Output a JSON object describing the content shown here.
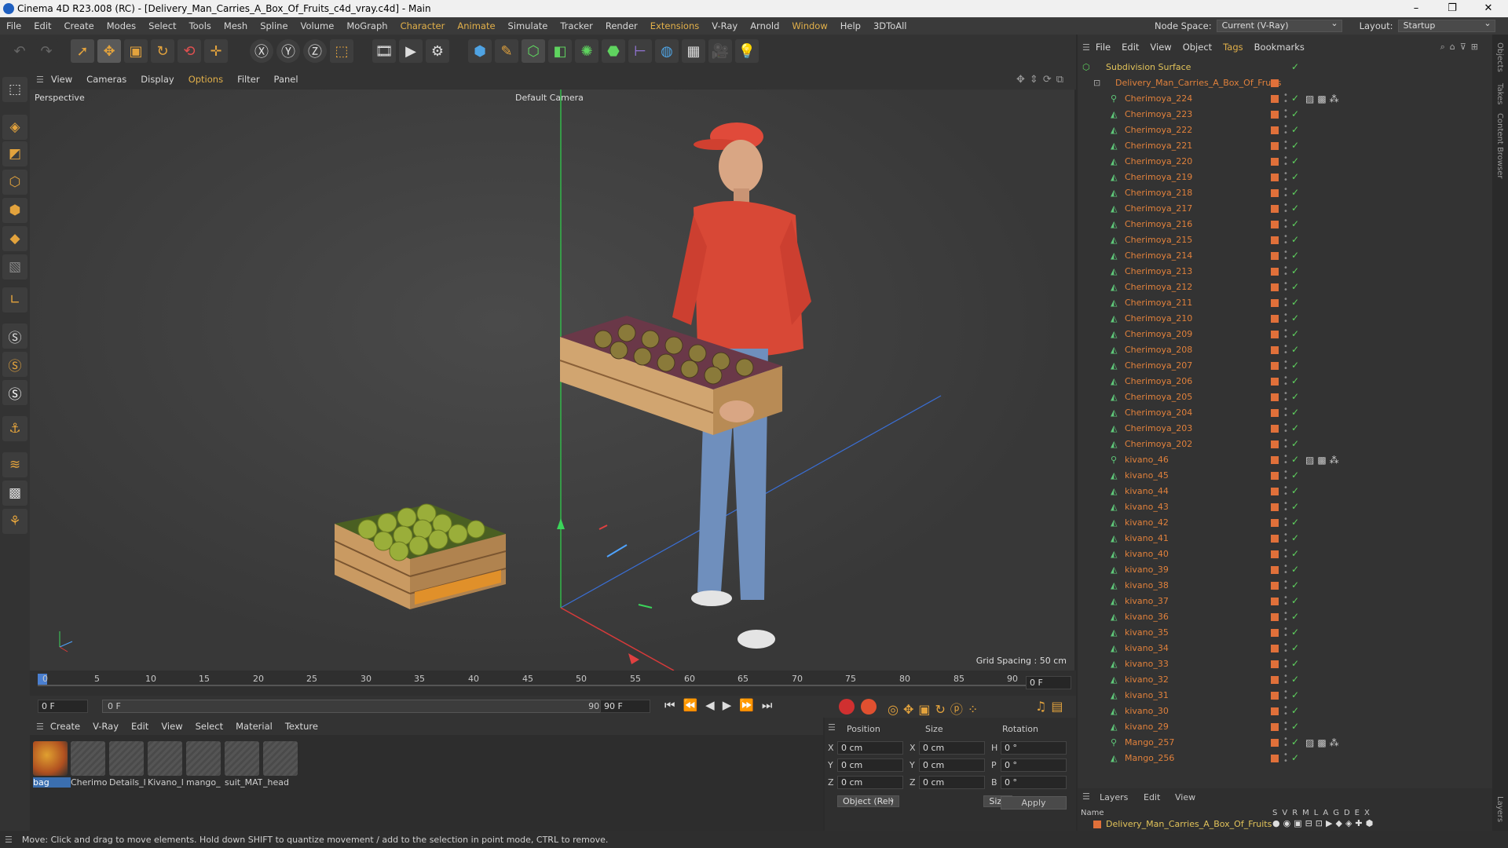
{
  "window": {
    "title": "Cinema 4D R23.008 (RC) - [Delivery_Man_Carries_A_Box_Of_Fruits_c4d_vray.c4d] - Main"
  },
  "menubar": {
    "items": [
      "File",
      "Edit",
      "Create",
      "Modes",
      "Select",
      "Tools",
      "Mesh",
      "Spline",
      "Volume",
      "MoGraph",
      "Character",
      "Animate",
      "Simulate",
      "Tracker",
      "Render",
      "Extensions",
      "V-Ray",
      "Arnold",
      "Window",
      "Help",
      "3DToAll"
    ],
    "node_space_label": "Node Space:",
    "node_space_value": "Current (V-Ray)",
    "layout_label": "Layout:",
    "layout_value": "Startup"
  },
  "viewport": {
    "menu": [
      "View",
      "Cameras",
      "Display",
      "Options",
      "Filter",
      "Panel"
    ],
    "name": "Perspective",
    "camera": "Default Camera",
    "grid_spacing": "Grid Spacing : 50 cm"
  },
  "timeline": {
    "ticks": [
      "0",
      "5",
      "10",
      "15",
      "20",
      "25",
      "30",
      "35",
      "40",
      "45",
      "50",
      "55",
      "60",
      "65",
      "70",
      "75",
      "80",
      "85",
      "90"
    ],
    "current_frame": "0 F",
    "start_field": "0 F",
    "range_start": "0 F",
    "range_end": "90 F",
    "end_field": "90 F",
    "right_field": "0 F"
  },
  "material_manager": {
    "menu": [
      "Create",
      "V-Ray",
      "Edit",
      "View",
      "Select",
      "Material",
      "Texture"
    ],
    "materials": [
      "bag",
      "Cherimo",
      "Details_l",
      "Kivano_l",
      "mango_",
      "suit_MAT",
      "_head"
    ]
  },
  "coordinates": {
    "headers": [
      "Position",
      "Size",
      "Rotation"
    ],
    "pos": {
      "x": "0 cm",
      "y": "0 cm",
      "z": "0 cm"
    },
    "size": {
      "x": "0 cm",
      "y": "0 cm",
      "z": "0 cm"
    },
    "rot": {
      "h": "0 °",
      "p": "0 °",
      "b": "0 °"
    },
    "axis_labels": {
      "x": "X",
      "y": "Y",
      "z": "Z",
      "h": "H",
      "p": "P",
      "b": "B"
    },
    "mode_dropdown": "Object (Rel)",
    "size_dropdown": "Size",
    "apply": "Apply"
  },
  "object_manager": {
    "menu": [
      "File",
      "Edit",
      "View",
      "Object",
      "Tags",
      "Bookmarks"
    ],
    "root": "Subdivision Surface",
    "group": "Delivery_Man_Carries_A_Box_Of_Fruits",
    "objects": [
      "Cherimoya_224",
      "Cherimoya_223",
      "Cherimoya_222",
      "Cherimoya_221",
      "Cherimoya_220",
      "Cherimoya_219",
      "Cherimoya_218",
      "Cherimoya_217",
      "Cherimoya_216",
      "Cherimoya_215",
      "Cherimoya_214",
      "Cherimoya_213",
      "Cherimoya_212",
      "Cherimoya_211",
      "Cherimoya_210",
      "Cherimoya_209",
      "Cherimoya_208",
      "Cherimoya_207",
      "Cherimoya_206",
      "Cherimoya_205",
      "Cherimoya_204",
      "Cherimoya_203",
      "Cherimoya_202",
      "kivano_46",
      "kivano_45",
      "kivano_44",
      "kivano_43",
      "kivano_42",
      "kivano_41",
      "kivano_40",
      "kivano_39",
      "kivano_38",
      "kivano_37",
      "kivano_36",
      "kivano_35",
      "kivano_34",
      "kivano_33",
      "kivano_32",
      "kivano_31",
      "kivano_30",
      "kivano_29",
      "Mango_257",
      "Mango_256"
    ]
  },
  "layers": {
    "menu": [
      "Layers",
      "Edit",
      "View"
    ],
    "name_header": "Name",
    "flags": [
      "S",
      "V",
      "R",
      "M",
      "L",
      "A",
      "G",
      "D",
      "E",
      "X"
    ],
    "layer_name": "Delivery_Man_Carries_A_Box_Of_Fruits"
  },
  "side_tabs": [
    "Objects",
    "Takes",
    "Content Browser",
    "Layers"
  ],
  "status": "Move: Click and drag to move elements. Hold down SHIFT to quantize movement / add to the selection in point mode, CTRL to remove."
}
